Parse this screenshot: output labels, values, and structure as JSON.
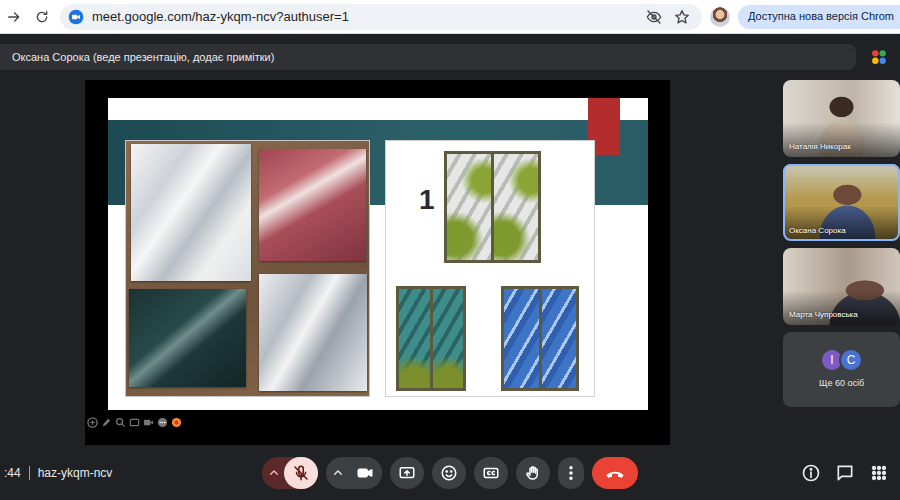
{
  "browser": {
    "url": "meet.google.com/haz-ykqm-ncv?authuser=1",
    "bookmarked": false,
    "update_button": "Доступна нова версія Chrom"
  },
  "presenter_banner": "Оксана Сорока (веде презентацію, додає примітки)",
  "slide": {
    "number": "1"
  },
  "participants": [
    {
      "name": "Наталія Никорак",
      "highlighted": false
    },
    {
      "name": "Оксана Сорока",
      "highlighted": true
    },
    {
      "name": "Марта Чупровська",
      "highlighted": false
    }
  ],
  "others": {
    "avatars": [
      {
        "letter": "І",
        "color": "#7e5bc4"
      },
      {
        "letter": "С",
        "color": "#4a72d4"
      }
    ],
    "label": "Ще 60 осіб"
  },
  "meeting": {
    "time": ":44",
    "code": "haz-ykqm-ncv"
  },
  "controls": [
    {
      "kind": "mic",
      "on": false
    },
    {
      "kind": "camera",
      "on": true
    },
    {
      "kind": "present"
    },
    {
      "kind": "emoji"
    },
    {
      "kind": "captions"
    },
    {
      "kind": "hand"
    },
    {
      "kind": "more"
    },
    {
      "kind": "leave"
    }
  ],
  "side_controls": [
    {
      "kind": "info"
    },
    {
      "kind": "chat"
    },
    {
      "kind": "apps"
    }
  ]
}
